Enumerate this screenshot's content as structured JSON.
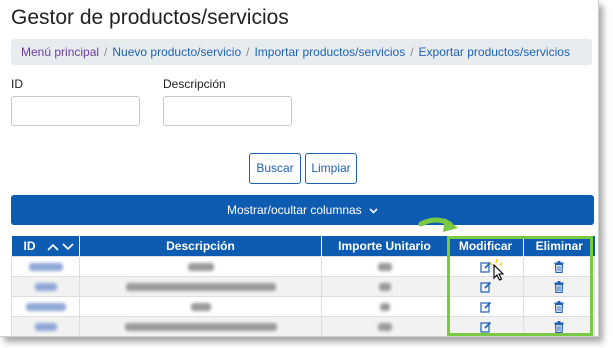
{
  "page": {
    "title": "Gestor de productos/servicios"
  },
  "breadcrumb": {
    "items": [
      {
        "label": "Menú principal"
      },
      {
        "label": "Nuevo producto/servicio"
      },
      {
        "label": "Importar productos/servicios"
      },
      {
        "label": "Exportar productos/servicios"
      }
    ],
    "separator": "/"
  },
  "filters": {
    "id_label": "ID",
    "id_value": "",
    "desc_label": "Descripción",
    "desc_value": "",
    "search_button": "Buscar",
    "clear_button": "Limpiar"
  },
  "columns_toggle": {
    "label": "Mostrar/ocultar columnas",
    "icon": "chevron-down-icon"
  },
  "table": {
    "headers": [
      "ID",
      "Descripción",
      "Importe Unitario",
      "Modificar",
      "Eliminar"
    ],
    "sort_icons": [
      "chevron-up-icon",
      "chevron-down-icon"
    ],
    "rows": 4,
    "modify_icon": "edit-icon",
    "delete_icon": "trash-icon"
  },
  "colors": {
    "primary": "#0d5cb2",
    "link": "#1e62b5",
    "visited_link": "#6a3fa0",
    "highlight": "#7ac943",
    "breadcrumb_bg": "#e9ecef"
  }
}
